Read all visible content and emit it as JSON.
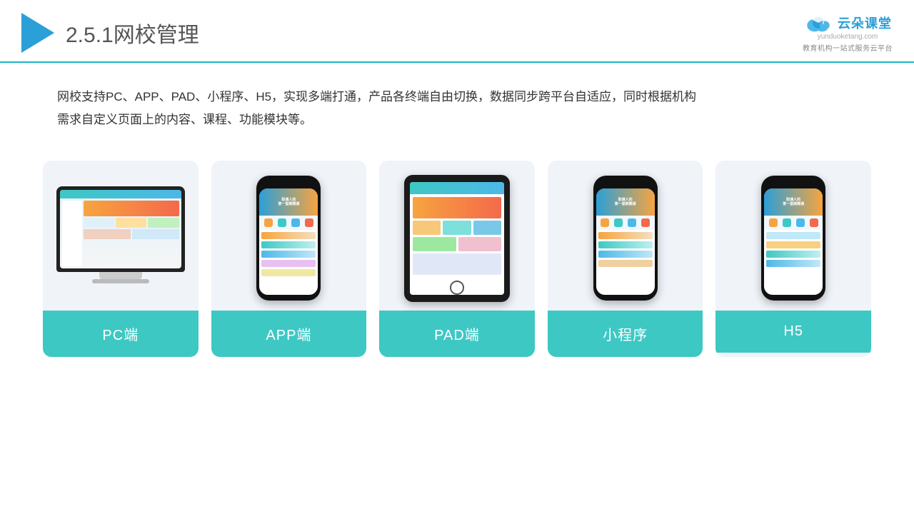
{
  "header": {
    "title_prefix": "2.5.1",
    "title_main": "网校管理",
    "logo_main": "云朵课堂",
    "logo_domain": "yunduoketang.com",
    "logo_tagline": "教育机构一站式服务云平台"
  },
  "description": {
    "text1": "网校支持PC、APP、PAD、小程序、H5，实现多端打通，产品各终端自由切换，数据同步跨平台自适应，同时根据机构",
    "text2": "需求自定义页面上的内容、课程、功能模块等。"
  },
  "cards": [
    {
      "id": "pc",
      "label": "PC端"
    },
    {
      "id": "app",
      "label": "APP端"
    },
    {
      "id": "pad",
      "label": "PAD端"
    },
    {
      "id": "mini",
      "label": "小程序"
    },
    {
      "id": "h5",
      "label": "H5"
    }
  ]
}
